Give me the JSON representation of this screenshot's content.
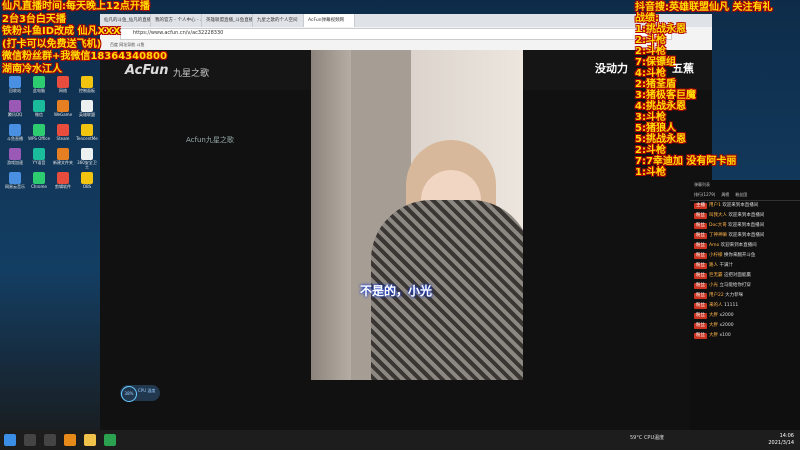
{
  "overlay_left": [
    "仙凡直播时间:每天晚上12点开播",
    "2台3台白天播",
    "铁粉斗鱼ID改成 仙凡XXX",
    "(打卡可以免费送飞机)",
    "微信粉丝群+我微信18364340800",
    "湖南冷水江人"
  ],
  "overlay_right": [
    "抖音搜:英雄联盟仙凡 关注有礼",
    "战绩:",
    "1:挑战永恩",
    "2:斗枪",
    "2:斗枪",
    "7:保镖组",
    "4:斗枪",
    "2:猪荃盾",
    "3:猪极客巨魔",
    "4:挑战永恩",
    "3:斗枪",
    "5:猪狼人",
    "5:挑战永恩",
    "2:斗枪",
    "7:7幸迪加 没有阿卡丽",
    "1:斗枪"
  ],
  "browser": {
    "tabs": [
      "仙凡的斗鱼_仙凡的直播间",
      "我的官方 - 个人中心 - 斗鱼",
      "英雄联盟直播_斗鱼直播",
      "九星之歌的个人空间",
      "AcFun弹幕视频网"
    ],
    "address": "https://www.acfun.cn/v/ac32228330",
    "bookmarks": "百度  网址导航  斗鱼"
  },
  "acfun": {
    "logo": "AcFun",
    "sub": "九星之歌",
    "watermark": "Acfun九星之歌"
  },
  "video": {
    "subtitle": "不是的，小光"
  },
  "captions": {
    "top1": "没动力",
    "top2": "五蕉"
  },
  "chat": {
    "header": "弹幕列表",
    "tabs": [
      "排行(1279)",
      "周榜",
      "粉丝团"
    ],
    "messages": [
      {
        "badge": "主播",
        "name": "用户1",
        "text": "欢迎来到本直播间"
      },
      {
        "badge": "粉丝",
        "name": "叫我大人",
        "text": "欢迎来到本直播间"
      },
      {
        "badge": "粉丝",
        "name": "Doc大哥",
        "text": "欢迎来到本直播间"
      },
      {
        "badge": "粉丝",
        "name": "丁神神嘛",
        "text": "欢迎来到本直播间"
      },
      {
        "badge": "粉丝",
        "name": "Amo",
        "text": "欢迎来到本直播间"
      },
      {
        "badge": "粉丝",
        "name": "小柠檬",
        "text": "换你来翻开斗鱼"
      },
      {
        "badge": "粉丝",
        "name": "路人",
        "text": "干满汁"
      },
      {
        "badge": "粉丝",
        "name": "巨无霸",
        "text": "这把对面能赢"
      },
      {
        "badge": "粉丝",
        "name": "小光",
        "text": "立马能给你打穿"
      },
      {
        "badge": "粉丝",
        "name": "用户22",
        "text": "大力菲咪"
      },
      {
        "badge": "粉丝",
        "name": "来的人",
        "text": "11111"
      },
      {
        "badge": "粉丝",
        "name": "大胖",
        "text": "x2000"
      },
      {
        "badge": "粉丝",
        "name": "大胖",
        "text": "x2000"
      },
      {
        "badge": "粉丝",
        "name": "大胖",
        "text": "x100"
      }
    ]
  },
  "cpu": {
    "value": "38%",
    "label": "CPU 温度"
  },
  "taskbar": {
    "time": "14:06",
    "date": "2021/3/14",
    "tray": "59°C CPU温度"
  },
  "colors": {
    "overlay_text": "#ffdd00",
    "overlay_stroke": "#b30000",
    "subtitle_glow": "#1a3fd0"
  },
  "desktop_icons": [
    "回收站",
    "此电脑",
    "网络",
    "控制面板",
    "腾讯QQ",
    "微信",
    "WeGame",
    "英雄联盟",
    "斗鱼直播",
    "WPS Office",
    "Steam",
    "TencentMe",
    "游戏加速",
    "YY语音",
    "新建文件夹",
    "360安全卫士",
    "网易云音乐",
    "Chrome",
    "剪辑软件",
    "OBS"
  ]
}
